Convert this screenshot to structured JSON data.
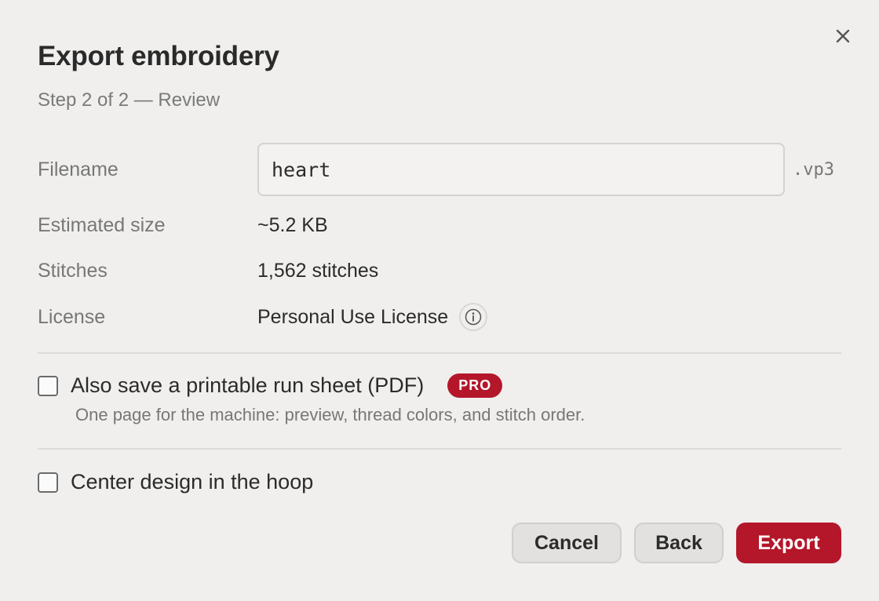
{
  "dialog": {
    "title": "Export embroidery",
    "subtitle": "Step 2 of 2 — Review"
  },
  "fields": {
    "filename": {
      "label": "Filename",
      "value": "heart",
      "extension": ".vp3"
    },
    "estimated_size": {
      "label": "Estimated size",
      "value": "~5.2 KB"
    },
    "stitches": {
      "label": "Stitches",
      "value": "1,562 stitches"
    },
    "license": {
      "label": "License",
      "value": "Personal Use License",
      "icon": "info-icon"
    }
  },
  "options": {
    "run_sheet": {
      "label": "Also save a printable run sheet (PDF)",
      "badge": "PRO",
      "help": "One page for the machine: preview, thread colors, and stitch order.",
      "checked": false
    },
    "center_design": {
      "label": "Center design in the hoop",
      "checked": false
    }
  },
  "buttons": {
    "cancel": "Cancel",
    "back": "Back",
    "export": "Export"
  },
  "colors": {
    "accent": "#b4172a",
    "background": "#f0efee"
  },
  "icons": {
    "close": "close-icon",
    "info": "info-icon"
  }
}
